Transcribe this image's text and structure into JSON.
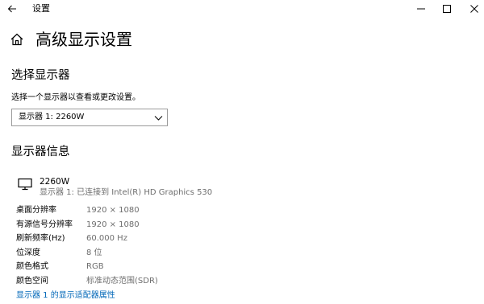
{
  "titlebar": {
    "title": "设置",
    "back_icon": "back-arrow-icon",
    "minimize_icon": "minimize-icon",
    "maximize_icon": "maximize-icon",
    "close_icon": "close-icon"
  },
  "header": {
    "home_icon": "home-icon",
    "title": "高级显示设置"
  },
  "select_display": {
    "heading": "选择显示器",
    "description": "选择一个显示器以查看或更改设置。",
    "dropdown": {
      "selected": "显示器 1: 2260W",
      "chevron_icon": "chevron-down-icon"
    }
  },
  "display_info": {
    "heading": "显示器信息",
    "monitor_icon": "monitor-icon",
    "monitor_name": "2260W",
    "connection": "显示器 1: 已连接到 Intel(R) HD Graphics 530",
    "rows": [
      {
        "label": "桌面分辨率",
        "value": "1920 × 1080"
      },
      {
        "label": "有源信号分辨率",
        "value": "1920 × 1080"
      },
      {
        "label": "刷新频率(Hz)",
        "value": "60.000 Hz"
      },
      {
        "label": "位深度",
        "value": "8 位"
      },
      {
        "label": "颜色格式",
        "value": "RGB"
      },
      {
        "label": "颜色空间",
        "value": "标准动态范围(SDR)"
      }
    ],
    "adapter_link": "显示器 1 的显示适配器属性"
  },
  "colors": {
    "link": "#0067b8",
    "secondary_text": "#6e6e6e",
    "border": "#9a9a9a"
  }
}
